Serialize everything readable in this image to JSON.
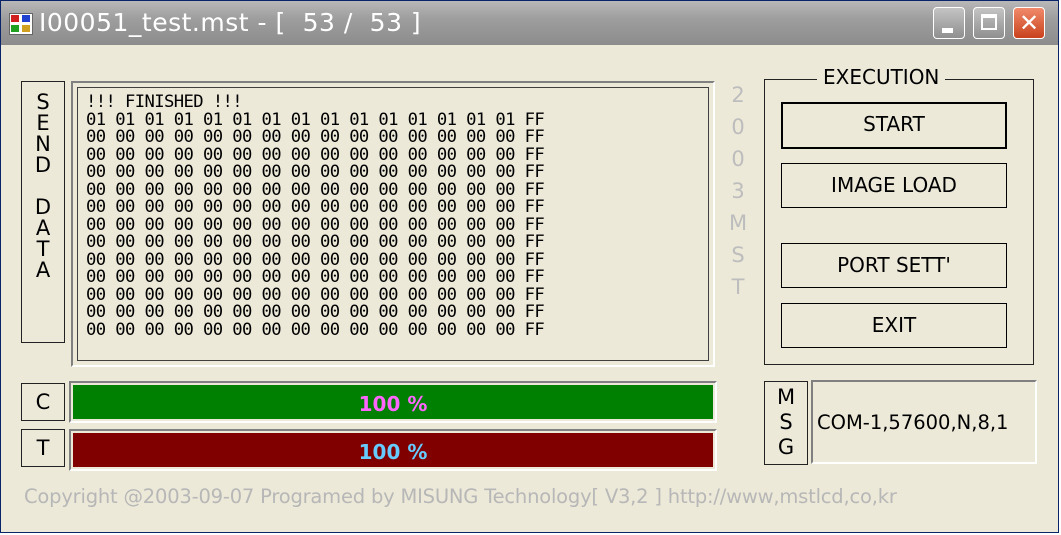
{
  "window": {
    "title": "I00051_test.mst - [  53 /  53 ]",
    "icon": "mst-app-icon"
  },
  "send_panel": {
    "label": "S\nE\nN\nD\n\nD\nA\nT\nA",
    "lines": [
      "!!! FINISHED !!!",
      "01 01 01 01 01 01 01 01 01 01 01 01 01 01 01 FF",
      "00 00 00 00 00 00 00 00 00 00 00 00 00 00 00 FF",
      "00 00 00 00 00 00 00 00 00 00 00 00 00 00 00 FF",
      "00 00 00 00 00 00 00 00 00 00 00 00 00 00 00 FF",
      "00 00 00 00 00 00 00 00 00 00 00 00 00 00 00 FF",
      "00 00 00 00 00 00 00 00 00 00 00 00 00 00 00 FF",
      "00 00 00 00 00 00 00 00 00 00 00 00 00 00 00 FF",
      "00 00 00 00 00 00 00 00 00 00 00 00 00 00 00 FF",
      "00 00 00 00 00 00 00 00 00 00 00 00 00 00 00 FF",
      "00 00 00 00 00 00 00 00 00 00 00 00 00 00 00 FF",
      "00 00 00 00 00 00 00 00 00 00 00 00 00 00 00 FF",
      "00 00 00 00 00 00 00 00 00 00 00 00 00 00 00 FF",
      "00 00 00 00 00 00 00 00 00 00 00 00 00 00 00 FF"
    ]
  },
  "side_mark": "2\n0\n0\n3\nM\nS\nT",
  "execution": {
    "legend": "EXECUTION",
    "start": "START",
    "image_load": "IMAGE LOAD",
    "port_settings": "PORT SETT'",
    "exit": "EXIT"
  },
  "progress": {
    "c_label": "C",
    "t_label": "T",
    "c_percent": 100,
    "t_percent": 100,
    "c_text": "100 %",
    "t_text": "100 %",
    "c_color": "#008000",
    "t_color": "#800000",
    "c_text_color": "#ff66ff",
    "t_text_color": "#66ccff"
  },
  "msg": {
    "label": "M\nS\nG",
    "text": "COM-1,57600,N,8,1"
  },
  "footer": "Copyright @2003-09-07 Programed by  MISUNG Technology[ V3,2 ] http://www,mstlcd,co,kr"
}
